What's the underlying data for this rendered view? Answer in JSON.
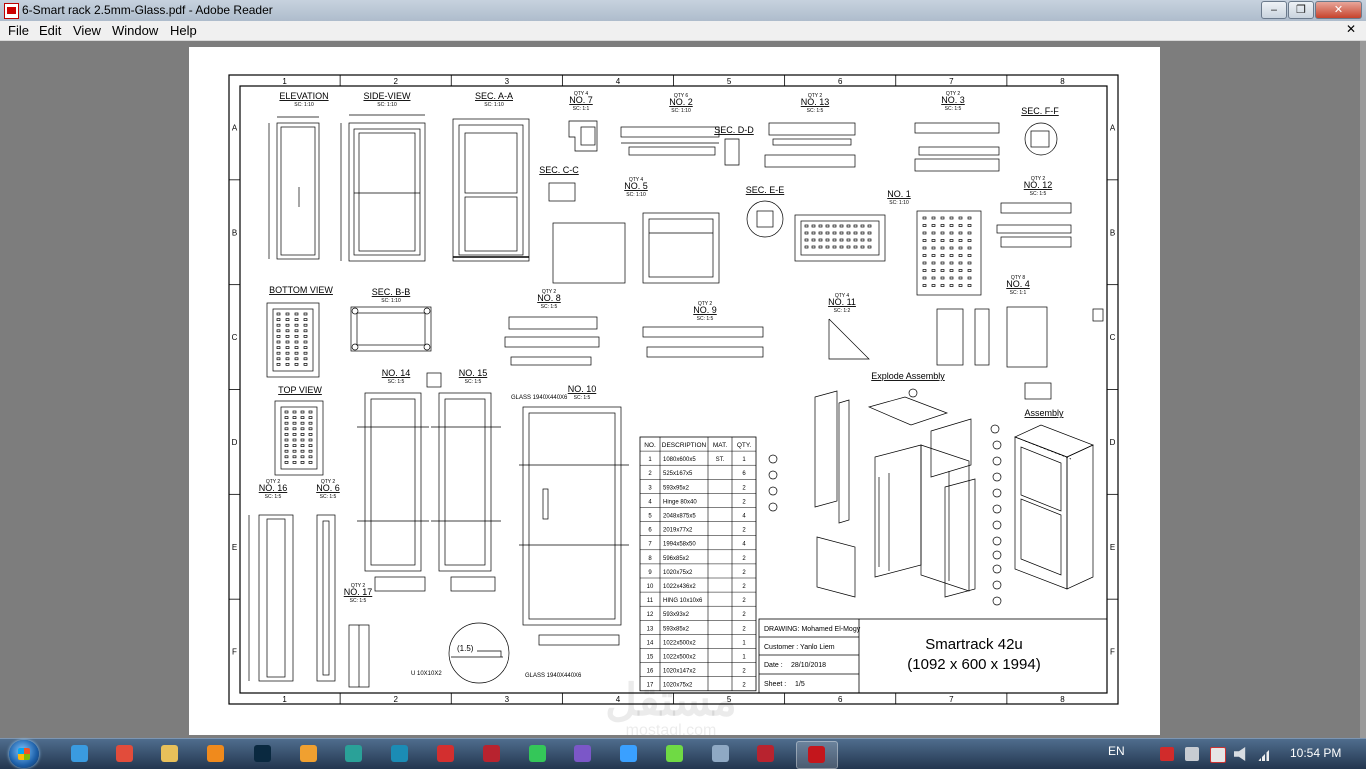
{
  "window": {
    "title": "6-Smart rack 2.5mm-Glass.pdf - Adobe Reader",
    "minimize_glyph": "‒",
    "maximize_glyph": "❐",
    "close_glyph": "✕",
    "doc_close_glyph": "✕"
  },
  "menu": [
    "File",
    "Edit",
    "View",
    "Window",
    "Help"
  ],
  "drawing": {
    "col_labels": [
      "1",
      "2",
      "3",
      "4",
      "5",
      "6",
      "7",
      "8"
    ],
    "row_labels": [
      "A",
      "B",
      "C",
      "D",
      "E",
      "F"
    ],
    "views": [
      {
        "title": "ELEVATION",
        "scale": "SC: 1:10"
      },
      {
        "title": "SIDE-VIEW",
        "scale": "SC: 1:10"
      },
      {
        "title": "SEC. A-A",
        "scale": "SC: 1:10"
      },
      {
        "title": "NO. 7",
        "qty": "QTY 4",
        "scale": "SC: 1:1"
      },
      {
        "title": "NO. 2",
        "qty": "QTY 6",
        "scale": "SC: 1:10"
      },
      {
        "title": "NO. 13",
        "qty": "QTY 2",
        "scale": "SC: 1:5"
      },
      {
        "title": "NO. 3",
        "qty": "QTY 2",
        "scale": "SC: 1:5"
      },
      {
        "title": "SEC. F-F"
      },
      {
        "title": "SEC. C-C"
      },
      {
        "title": "SEC. D-D"
      },
      {
        "title": "NO. 5",
        "qty": "QTY 4",
        "scale": "SC: 1:10"
      },
      {
        "title": "SEC. E-E"
      },
      {
        "title": "NO. 1",
        "scale": "SC: 1:10"
      },
      {
        "title": "NO. 12",
        "qty": "QTY 2",
        "scale": "SC: 1:5"
      },
      {
        "title": "BOTTOM VIEW"
      },
      {
        "title": "SEC. B-B",
        "scale": "SC: 1:10"
      },
      {
        "title": "NO. 8",
        "qty": "QTY 2",
        "scale": "SC: 1:5"
      },
      {
        "title": "NO. 9",
        "qty": "QTY 2",
        "scale": "SC: 1:5"
      },
      {
        "title": "NO. 11",
        "qty": "QTY 4",
        "scale": "SC: 1:2"
      },
      {
        "title": "NO. 4",
        "qty": "QTY 8",
        "scale": "SC: 1:1"
      },
      {
        "title": "TOP VIEW"
      },
      {
        "title": "NO. 14",
        "scale": "SC: 1:5"
      },
      {
        "title": "NO. 15",
        "scale": "SC: 1:5"
      },
      {
        "title": "NO. 10",
        "scale": "SC: 1:5"
      },
      {
        "title": "Explode Assembly"
      },
      {
        "title": "Assembly"
      },
      {
        "title": "NO. 16",
        "qty": "QTY 2",
        "scale": "SC: 1:5"
      },
      {
        "title": "NO. 6",
        "qty": "QTY 2",
        "scale": "SC: 1:5"
      },
      {
        "title": "NO. 17",
        "qty": "QTY 2",
        "scale": "SC: 1:5"
      }
    ],
    "notes": {
      "glass_top": "GLASS 1940X440X6",
      "glass_bottom": "GLASS 1940X440X6",
      "detail": "(1.5)",
      "u_profile": "U 10X10X2"
    },
    "bom": {
      "headers": [
        "NO.",
        "DESCRIPTION",
        "MAT.",
        "QTY."
      ],
      "rows": [
        [
          "1",
          "1080x600x5",
          "ST.",
          "1"
        ],
        [
          "2",
          "525x167x5",
          "",
          "6"
        ],
        [
          "3",
          "593x95x2",
          "",
          "2"
        ],
        [
          "4",
          "Hinge 80x40",
          "",
          "2"
        ],
        [
          "5",
          "2048x875x5",
          "",
          "4"
        ],
        [
          "6",
          "2019x77x2",
          "",
          "2"
        ],
        [
          "7",
          "1994x58x50",
          "",
          "4"
        ],
        [
          "8",
          "596x85x2",
          "",
          "2"
        ],
        [
          "9",
          "1020x75x2",
          "",
          "2"
        ],
        [
          "10",
          "1022x436x2",
          "",
          "2"
        ],
        [
          "11",
          "HING 10x10x6",
          "",
          "2"
        ],
        [
          "12",
          "593x93x2",
          "",
          "2"
        ],
        [
          "13",
          "593x85x2",
          "",
          "2"
        ],
        [
          "14",
          "1022x500x2",
          "",
          "1"
        ],
        [
          "15",
          "1022x500x2",
          "",
          "1"
        ],
        [
          "16",
          "1020x147x2",
          "",
          "2"
        ],
        [
          "17",
          "1020x75x2",
          "",
          "2"
        ]
      ]
    },
    "title_block": {
      "drawing": "DRAWING: Mohamed El-Mogy",
      "customer": "Customer : Yanlo Liem",
      "date_label": "Date :",
      "date": "28/10/2018",
      "sheet_label": "Sheet :",
      "sheet": "1/5",
      "title": "Smartrack 42u",
      "subtitle": "(1092 x 600 x 1994)"
    },
    "watermark": "مستقل",
    "watermark_sub": "mostaql.com"
  },
  "taskbar": {
    "apps": [
      {
        "name": "ie",
        "color": "#3a9be0"
      },
      {
        "name": "chrome",
        "color": "#e24c3b"
      },
      {
        "name": "explorer",
        "color": "#e8c05a"
      },
      {
        "name": "media-player",
        "color": "#f08a1c"
      },
      {
        "name": "photoshop",
        "color": "#0a2940"
      },
      {
        "name": "app-a",
        "color": "#f0a030"
      },
      {
        "name": "app-3",
        "color": "#2aa198"
      },
      {
        "name": "app-arrow",
        "color": "#1b8cb5"
      },
      {
        "name": "acrobat-a",
        "color": "#d32f2f"
      },
      {
        "name": "solidworks",
        "color": "#b8232f"
      },
      {
        "name": "whatsapp",
        "color": "#34c759"
      },
      {
        "name": "viber",
        "color": "#7b57c8"
      },
      {
        "name": "app-cloud",
        "color": "#3aa0ff"
      },
      {
        "name": "upwork",
        "color": "#6fda44"
      },
      {
        "name": "calculator",
        "color": "#8fa9c4"
      },
      {
        "name": "solidworks-2",
        "color": "#b8232f"
      },
      {
        "name": "adobe-reader",
        "color": "#c4161c"
      }
    ],
    "language": "EN",
    "time": "10:54 PM"
  }
}
